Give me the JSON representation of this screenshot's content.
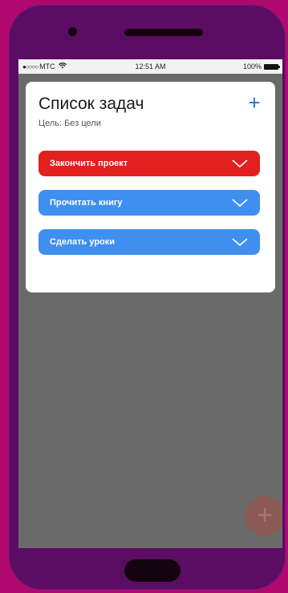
{
  "statusbar": {
    "carrier": "МТС",
    "signal_dots": "●○○○○",
    "time": "12:51 AM",
    "battery": "100%"
  },
  "header": {
    "title": "Список задач",
    "subtitle": "Цель: Без цели",
    "add_label": "+"
  },
  "tasks": [
    {
      "label": "Закончить проект",
      "color": "#e1201f"
    },
    {
      "label": "Прочитать книгу",
      "color": "#3f8ff0"
    },
    {
      "label": "Сделать уроки",
      "color": "#3f8ff0"
    }
  ],
  "fab": {
    "label": "+"
  },
  "colors": {
    "background": "#b0096e",
    "phone": "#5a0d63",
    "accent": "#2b6fe0"
  }
}
